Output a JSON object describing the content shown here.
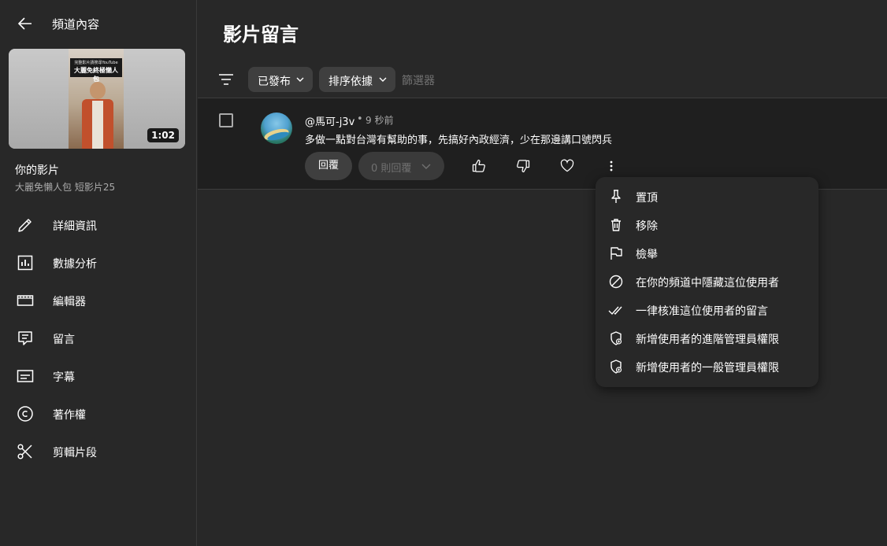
{
  "sidebar": {
    "header_title": "頻道內容",
    "thumbnail": {
      "duration": "1:02",
      "overlay_small": "完整影片請搜尋YouTube",
      "overlay_big": "大麗免終極懶人包"
    },
    "video_title": "你的影片",
    "video_subtitle": "大麗免懶人包 短影片25",
    "items": [
      {
        "label": "詳細資訊",
        "icon": "pencil-icon"
      },
      {
        "label": "數據分析",
        "icon": "analytics-icon"
      },
      {
        "label": "編輯器",
        "icon": "editor-icon"
      },
      {
        "label": "留言",
        "icon": "comments-icon"
      },
      {
        "label": "字幕",
        "icon": "subtitles-icon"
      },
      {
        "label": "著作權",
        "icon": "copyright-icon"
      },
      {
        "label": "剪輯片段",
        "icon": "scissors-icon"
      }
    ]
  },
  "main": {
    "title": "影片留言",
    "filters": {
      "published_label": "已發布",
      "sort_label": "排序依據",
      "placeholder": "篩選器"
    },
    "comment": {
      "author": "@馬可-j3v",
      "separator": "•",
      "time": "9 秒前",
      "text": "多做一點對台灣有幫助的事，先搞好內政經濟，少在那邊講口號閃兵",
      "reply_label": "回覆",
      "replies_label": "0 則回覆"
    }
  },
  "menu": {
    "items": [
      {
        "label": "置頂",
        "icon": "pin-icon"
      },
      {
        "label": "移除",
        "icon": "trash-icon"
      },
      {
        "label": "檢舉",
        "icon": "flag-icon"
      },
      {
        "label": "在你的頻道中隱藏這位使用者",
        "icon": "block-icon"
      },
      {
        "label": "一律核准這位使用者的留言",
        "icon": "double-check-icon"
      },
      {
        "label": "新增使用者的進階管理員權限",
        "icon": "shield-add-icon"
      },
      {
        "label": "新增使用者的一般管理員權限",
        "icon": "shield-add-icon"
      }
    ]
  },
  "colors": {
    "background": "#282828",
    "comment_row": "#1f1f1f",
    "chip": "#3f3f3f",
    "muted_text": "#aaaaaa"
  }
}
